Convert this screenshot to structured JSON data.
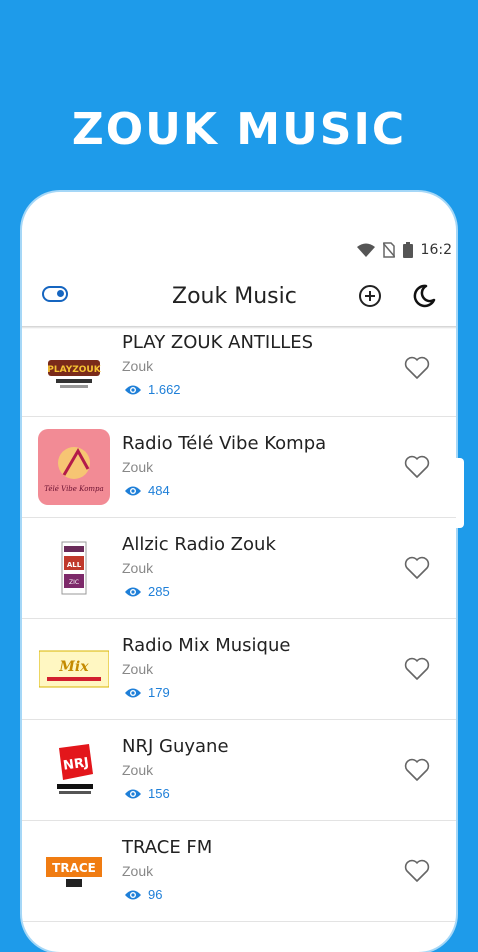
{
  "promo": {
    "title": "ZOUK MUSIC"
  },
  "status_bar": {
    "time": "16:2"
  },
  "app_bar": {
    "title": "Zouk Music"
  },
  "colors": {
    "background": "#1E9BEA",
    "accent": "#1E7FD8",
    "toggle": "#1565C0"
  },
  "stations": [
    {
      "name": "PLAY ZOUK ANTILLES",
      "genre": "Zouk",
      "views": "1.662",
      "logo": "playzouk-logo"
    },
    {
      "name": "Radio Télé Vibe Kompa",
      "genre": "Zouk",
      "views": "484",
      "logo": "vibe-kompa-logo"
    },
    {
      "name": "Allzic Radio Zouk",
      "genre": "Zouk",
      "views": "285",
      "logo": "allzic-logo"
    },
    {
      "name": "Radio Mix Musique",
      "genre": "Zouk",
      "views": "179",
      "logo": "mix-musique-logo"
    },
    {
      "name": "NRJ Guyane",
      "genre": "Zouk",
      "views": "156",
      "logo": "nrj-logo"
    },
    {
      "name": "TRACE FM",
      "genre": "Zouk",
      "views": "96",
      "logo": "trace-fm-logo"
    }
  ]
}
